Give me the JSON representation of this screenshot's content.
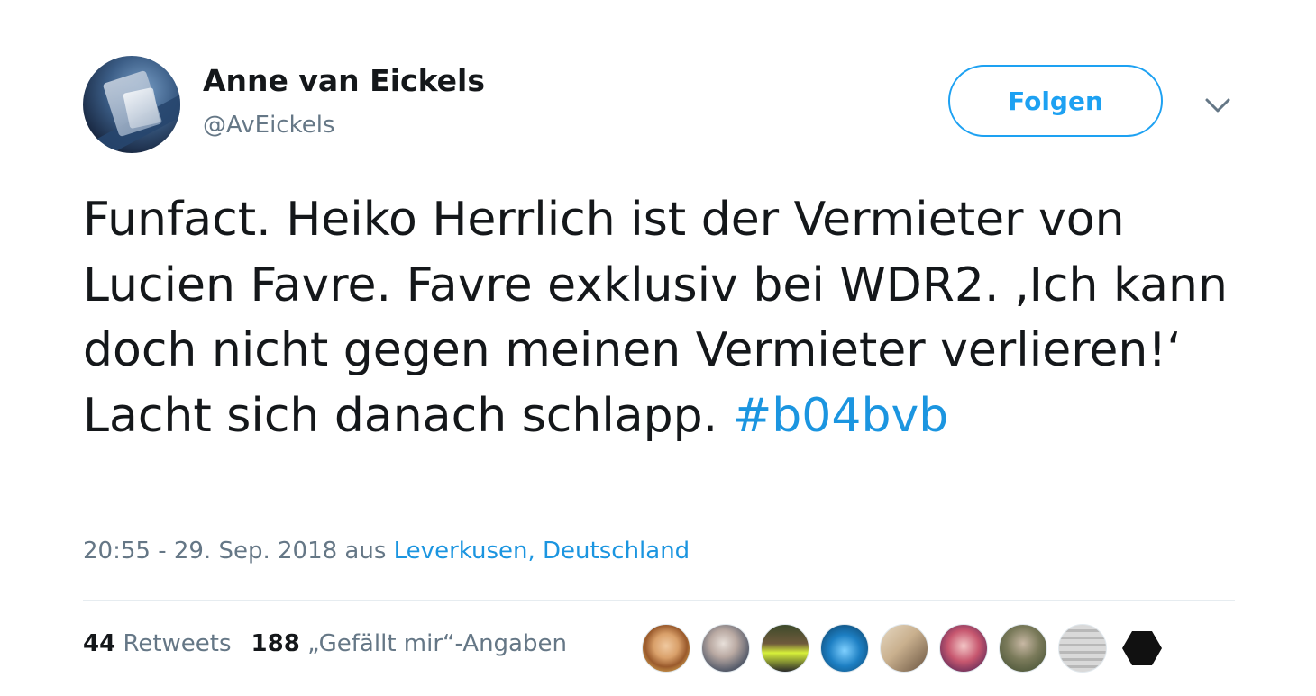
{
  "author": {
    "display_name": "Anne van Eickels",
    "handle": "@AvEickels",
    "avatar_icon": "profile-photo"
  },
  "follow_button": {
    "label": "Folgen"
  },
  "menu": {
    "icon": "chevron-down-icon"
  },
  "tweet": {
    "text": "Funfact. Heiko Herrlich ist der Vermieter von Lucien Favre. Favre exklusiv bei WDR2. ‚Ich kann doch nicht gegen meinen Vermieter verlieren!‘ Lacht sich danach schlapp.",
    "hashtag": "#b04bvb"
  },
  "meta": {
    "timestamp": "20:55 - 29. Sep. 2018",
    "from_label": "aus",
    "location": "Leverkusen, Deutschland"
  },
  "stats": {
    "retweets_count": "44",
    "retweets_label": "Retweets",
    "likes_count": "188",
    "likes_label": "„Gefällt mir“-Angaben"
  },
  "likers": [
    {
      "name": "liker-avatar-1"
    },
    {
      "name": "liker-avatar-2"
    },
    {
      "name": "liker-avatar-3"
    },
    {
      "name": "liker-avatar-4"
    },
    {
      "name": "liker-avatar-5"
    },
    {
      "name": "liker-avatar-6"
    },
    {
      "name": "liker-avatar-7"
    },
    {
      "name": "liker-avatar-8"
    },
    {
      "name": "liker-avatar-9"
    }
  ],
  "colors": {
    "accent": "#1da1f2",
    "link": "#1b95e0",
    "secondary_text": "#657786",
    "primary_text": "#14171a"
  }
}
